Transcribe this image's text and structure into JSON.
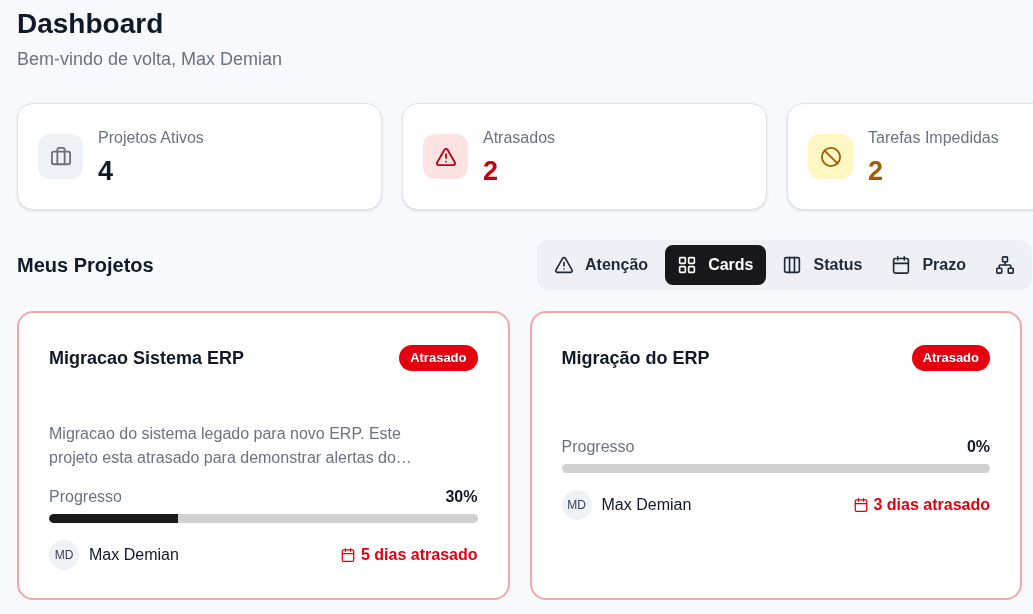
{
  "header": {
    "title": "Dashboard",
    "subtitle": "Bem-vindo de volta, Max Demian"
  },
  "stats": [
    {
      "kind": "neutral",
      "label": "Projetos Ativos",
      "value": "4"
    },
    {
      "kind": "danger",
      "label": "Atrasados",
      "value": "2"
    },
    {
      "kind": "warning",
      "label": "Tarefas Impedidas",
      "value": "2"
    }
  ],
  "projects_section": {
    "title": "Meus Projetos",
    "view_tabs": [
      {
        "label": "Atenção",
        "selected": false
      },
      {
        "label": "Cards",
        "selected": true
      },
      {
        "label": "Status",
        "selected": false
      },
      {
        "label": "Prazo",
        "selected": false
      },
      {
        "selected": false
      }
    ]
  },
  "projects": [
    {
      "title": "Migracao Sistema ERP",
      "badge": "Atrasado",
      "description": "Migracao do sistema legado para novo ERP. Este projeto esta atrasado para demonstrar alertas do…",
      "progress": {
        "label": "Progresso",
        "reading": "30%",
        "level": 0.3
      },
      "owner": {
        "initials": "MD",
        "name": "Max Demian"
      },
      "due": {
        "text": "5 dias atrasado",
        "overdue": true
      }
    },
    {
      "title": "Migração do ERP",
      "badge": "Atrasado",
      "progress": {
        "label": "Progresso",
        "reading": "0%"
      },
      "owner": {
        "initials": "MD",
        "name": "Max Demian"
      },
      "due": {
        "text": "3 dias atrasado",
        "overdue": true
      }
    }
  ]
}
